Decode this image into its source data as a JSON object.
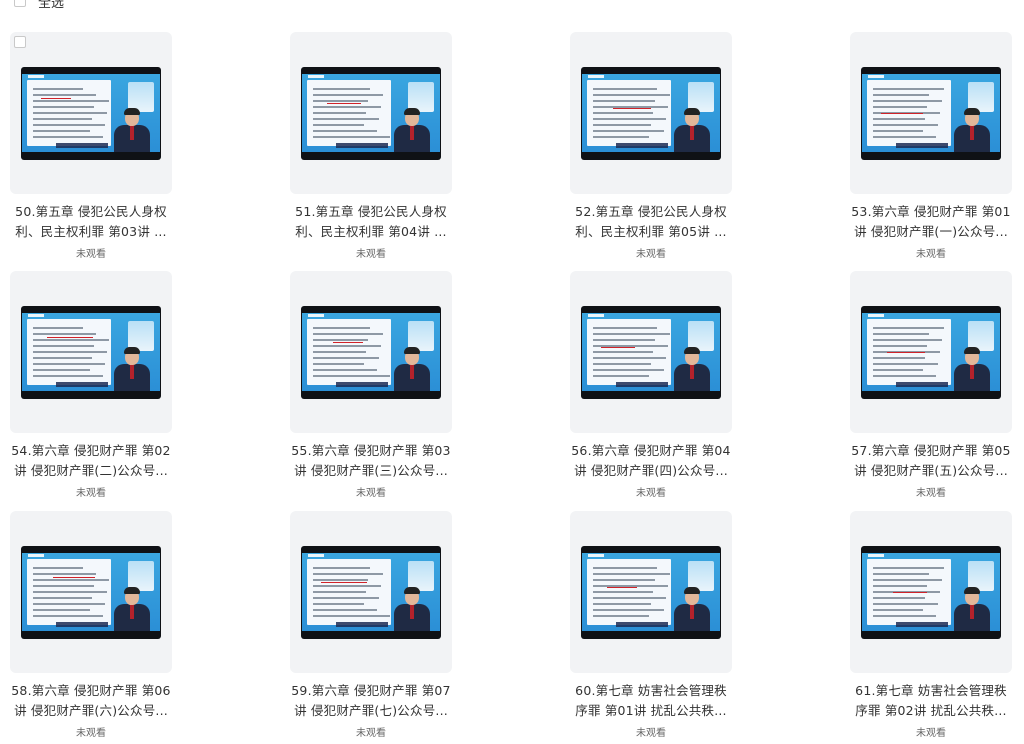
{
  "header": {
    "select_all_label": "全选"
  },
  "courses": [
    {
      "title": "50.第五章 侵犯公民人身权利、民主权利罪 第03讲 ...",
      "status": "未观看"
    },
    {
      "title": "51.第五章 侵犯公民人身权利、民主权利罪 第04讲 ...",
      "status": "未观看"
    },
    {
      "title": "52.第五章 侵犯公民人身权利、民主权利罪 第05讲 ...",
      "status": "未观看"
    },
    {
      "title": "53.第六章 侵犯财产罪 第01讲 侵犯财产罪(一)公众号...",
      "status": "未观看"
    },
    {
      "title": "54.第六章 侵犯财产罪 第02讲 侵犯财产罪(二)公众号...",
      "status": "未观看"
    },
    {
      "title": "55.第六章 侵犯财产罪 第03讲 侵犯财产罪(三)公众号...",
      "status": "未观看"
    },
    {
      "title": "56.第六章 侵犯财产罪 第04讲 侵犯财产罪(四)公众号...",
      "status": "未观看"
    },
    {
      "title": "57.第六章 侵犯财产罪 第05讲 侵犯财产罪(五)公众号...",
      "status": "未观看"
    },
    {
      "title": "58.第六章 侵犯财产罪 第06讲 侵犯财产罪(六)公众号...",
      "status": "未观看"
    },
    {
      "title": "59.第六章 侵犯财产罪 第07讲 侵犯财产罪(七)公众号...",
      "status": "未观看"
    },
    {
      "title": "60.第七章 妨害社会管理秩序罪 第01讲 扰乱公共秩...",
      "status": "未观看"
    },
    {
      "title": "61.第七章 妨害社会管理秩序罪 第02讲 扰乱公共秩...",
      "status": "未观看"
    }
  ]
}
